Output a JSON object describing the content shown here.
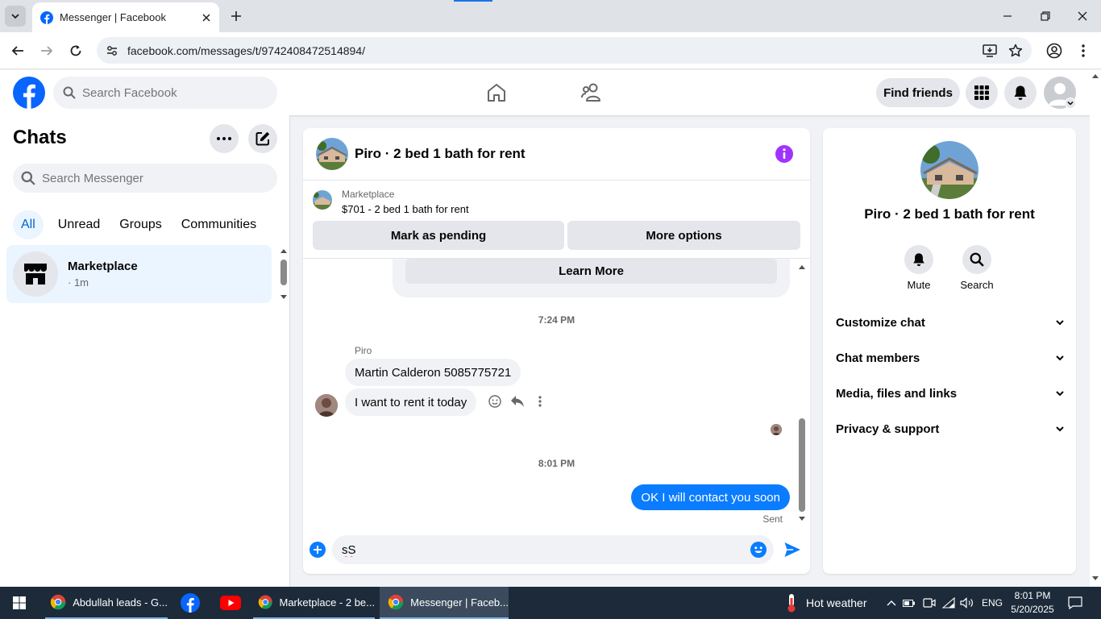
{
  "browser": {
    "tab_title": "Messenger | Facebook",
    "url": "facebook.com/messages/t/9742408472514894/"
  },
  "fb_header": {
    "search_placeholder": "Search Facebook",
    "find_friends": "Find friends"
  },
  "sidebar": {
    "title": "Chats",
    "search_placeholder": "Search Messenger",
    "filters": [
      "All",
      "Unread",
      "Groups",
      "Communities"
    ],
    "active_filter": "All",
    "chats": [
      {
        "name": "Marketplace",
        "meta": "· 1m"
      }
    ]
  },
  "conversation": {
    "title": "Piro · 2 bed 1 bath for rent",
    "listing": {
      "label": "Marketplace",
      "title": "$701 - 2 bed 1 bath for rent",
      "mark_pending": "Mark as pending",
      "more_options": "More options"
    },
    "learn_more": "Learn More",
    "time1": "7:24 PM",
    "sender": "Piro",
    "incoming": [
      "Martin Calderon 5085775721",
      "I want to rent it today"
    ],
    "time2": "8:01 PM",
    "outgoing": "OK I will contact you soon",
    "status": "Sent",
    "composer_value": "sS"
  },
  "details": {
    "name": "Piro · 2 bed 1 bath for rent",
    "actions": [
      "Mute",
      "Search"
    ],
    "sections": [
      "Customize chat",
      "Chat members",
      "Media, files and links",
      "Privacy & support"
    ]
  },
  "taskbar": {
    "items": [
      "Abdullah leads - G...",
      "Marketplace - 2 be...",
      "Messenger | Faceb..."
    ],
    "weather": "Hot weather",
    "lang": "ENG",
    "time": "8:01 PM",
    "date": "5/20/2025"
  },
  "colors": {
    "fb_blue": "#0866ff",
    "bubble_out": "#0a7cff",
    "info_purple": "#a033ff",
    "taskbar": "#1c2a3a"
  }
}
